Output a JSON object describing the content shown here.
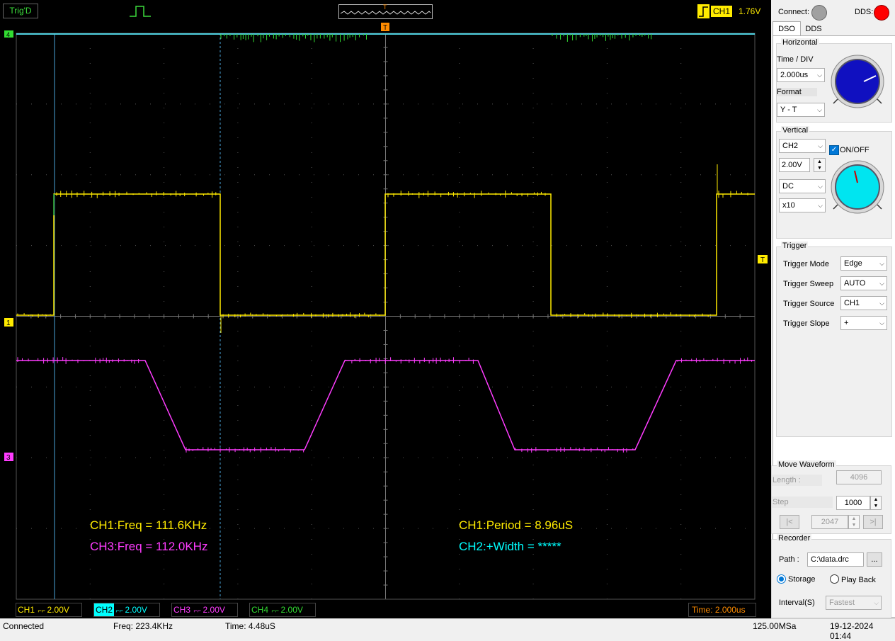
{
  "top": {
    "trig_status": "Trig'D",
    "wave_preview_marker": "T",
    "trigger_channel": "CH1",
    "trigger_level": "1.76V"
  },
  "screen": {
    "marker_T": "T",
    "ch_markers": {
      "ch4": "4",
      "ch1": "1",
      "ch3": "3",
      "trig_level": "T"
    },
    "measurements": {
      "ch1_freq": "CH1:Freq = 111.6KHz",
      "ch3_freq": "CH3:Freq = 112.0KHz",
      "ch1_period": "CH1:Period = 8.96uS",
      "ch2_width": "CH2:+Width = *****"
    },
    "colors": {
      "ch1": "#ffeb00",
      "ch2": "#00ffff",
      "ch3": "#ff3cff",
      "ch4": "#32dc32",
      "trigger": "#ff8c00"
    }
  },
  "channel_bar": {
    "ch1": {
      "name": "CH1",
      "scale": "2.00V"
    },
    "ch2": {
      "name": "CH2",
      "scale": "2.00V"
    },
    "ch3": {
      "name": "CH3",
      "scale": "2.00V"
    },
    "ch4": {
      "name": "CH4",
      "scale": "2.00V"
    },
    "time": "Time: 2.000us"
  },
  "status": {
    "connection": "Connected",
    "freq": "Freq: 223.4KHz",
    "time": "Time: 4.48uS",
    "sample_rate": "125.00MSa",
    "datetime": "19-12-2024  01:44"
  },
  "panel": {
    "connect_label": "Connect:",
    "dds_label": "DDS:",
    "tabs": [
      "DSO",
      "DDS"
    ],
    "horizontal": {
      "title": "Horizontal",
      "time_div_label": "Time / DIV",
      "time_div": "2.000us",
      "format_label": "Format",
      "format": "Y - T"
    },
    "vertical": {
      "title": "Vertical",
      "channel": "CH2",
      "on_off": "ON/OFF",
      "volts": "2.00V",
      "coupling": "DC",
      "probe": "x10"
    },
    "trigger": {
      "title": "Trigger",
      "mode_label": "Trigger Mode",
      "mode": "Edge",
      "sweep_label": "Trigger Sweep",
      "sweep": "AUTO",
      "source_label": "Trigger Source",
      "source": "CH1",
      "slope_label": "Trigger Slope",
      "slope": "+"
    },
    "move_waveform": {
      "title": "Move Waveform",
      "length_label": "Length :",
      "length": "4096",
      "step_label": "Step",
      "step": "1000",
      "position": "2047",
      "prev": "|<",
      "next": ">|"
    },
    "recorder": {
      "title": "Recorder",
      "path_label": "Path :",
      "path": "C:\\data.drc",
      "browse": "...",
      "storage": "Storage",
      "playback": "Play Back",
      "interval_label": "Interval(S)",
      "interval": "Fastest"
    }
  }
}
